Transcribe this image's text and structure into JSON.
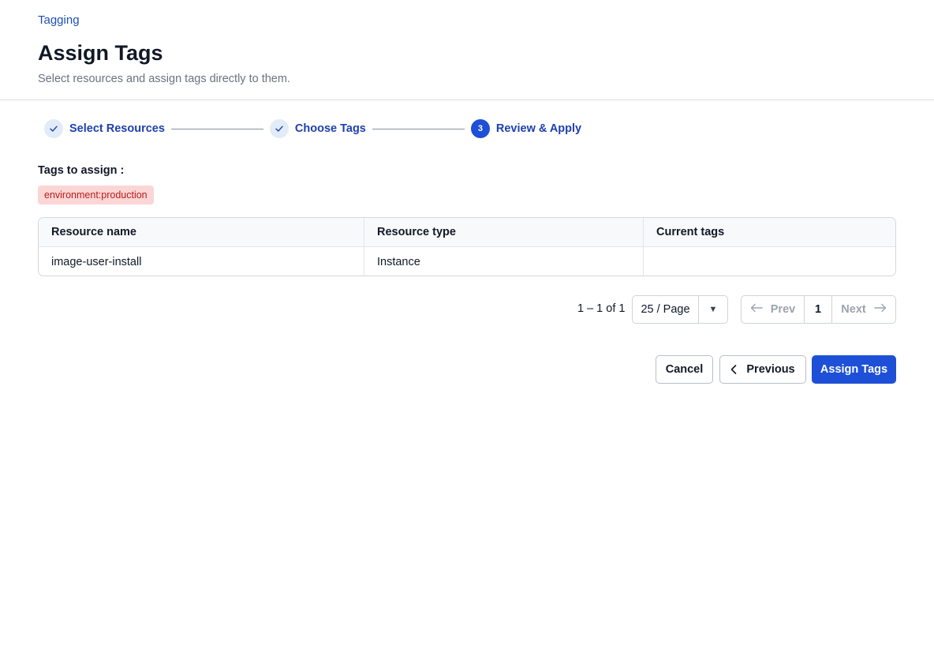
{
  "breadcrumb": "Tagging",
  "header": {
    "title": "Assign Tags",
    "subtitle": "Select resources and assign tags directly to them."
  },
  "stepper": {
    "steps": [
      {
        "label": "Select Resources",
        "status": "done",
        "icon": "check-icon"
      },
      {
        "label": "Choose Tags",
        "status": "done",
        "icon": "check-icon"
      },
      {
        "label": "Review & Apply",
        "status": "active",
        "number": "3"
      }
    ]
  },
  "tags_section": {
    "label": "Tags to assign :",
    "tags": [
      "environment:production"
    ]
  },
  "table": {
    "columns": [
      "Resource name",
      "Resource type",
      "Current tags"
    ],
    "rows": [
      {
        "name": "image-user-install",
        "type": "Instance",
        "tags": ""
      }
    ]
  },
  "pagination": {
    "range": "1 – 1 of 1",
    "per_page": "25 / Page",
    "prev_label": "Prev",
    "current_page": "1",
    "next_label": "Next"
  },
  "actions": {
    "cancel": "Cancel",
    "previous": "Previous",
    "assign": "Assign Tags"
  },
  "colors": {
    "primary": "#1d4fd7",
    "step_text": "#1e40af",
    "tag_bg": "#fcd5d5",
    "tag_text": "#b91c1c"
  }
}
